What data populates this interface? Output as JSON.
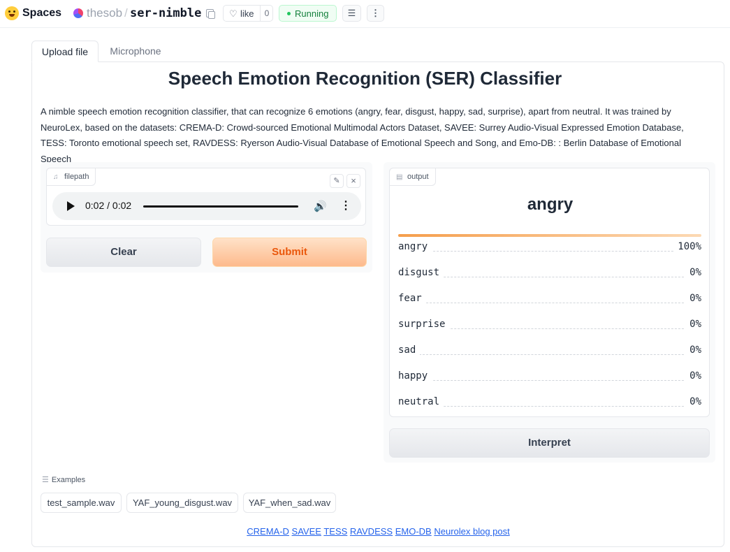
{
  "header": {
    "spaces_label": "Spaces",
    "owner": "thesob",
    "separator": "/",
    "repo": "ser-nimble",
    "like_label": "like",
    "like_count": "0",
    "status": "Running",
    "status_color": "#15803d",
    "logs_icon": "list-icon",
    "more_icon": "⋮"
  },
  "tabs": [
    {
      "label": "Upload file",
      "active": true
    },
    {
      "label": "Microphone",
      "active": false
    }
  ],
  "title": "Speech Emotion Recognition (SER) Classifier",
  "description": "A nimble speech emotion recognition classifier, that can recognize 6 emotions (angry, fear, disgust, happy, sad, surprise), apart from neutral. It was trained by NeuroLex, based on the datasets: CREMA-D: Crowd-sourced Emotional Multimodal Actors Dataset, SAVEE: Surrey Audio-Visual Expressed Emotion Database, TESS: Toronto emotional speech set, RAVDESS: Ryerson Audio-Visual Database of Emotional Speech and Song, and Emo-DB: : Berlin Database of Emotional Speech",
  "input": {
    "label": "filepath",
    "player_time": "0:02 / 0:02",
    "progress": 1.0
  },
  "buttons": {
    "clear": "Clear",
    "submit": "Submit",
    "interpret": "Interpret"
  },
  "output": {
    "label": "output",
    "predicted": "angry",
    "confidences": [
      {
        "label": "angry",
        "value": "100%",
        "fraction": 1.0
      },
      {
        "label": "disgust",
        "value": "0%",
        "fraction": 0
      },
      {
        "label": "fear",
        "value": "0%",
        "fraction": 0
      },
      {
        "label": "surprise",
        "value": "0%",
        "fraction": 0
      },
      {
        "label": "sad",
        "value": "0%",
        "fraction": 0
      },
      {
        "label": "happy",
        "value": "0%",
        "fraction": 0
      },
      {
        "label": "neutral",
        "value": "0%",
        "fraction": 0
      }
    ],
    "accent_color": "#f59e4c"
  },
  "examples": {
    "label": "Examples",
    "items": [
      "test_sample.wav",
      "YAF_young_disgust.wav",
      "YAF_when_sad.wav"
    ]
  },
  "footer_links": [
    "CREMA-D",
    "SAVEE",
    "TESS",
    "RAVDESS",
    "EMO-DB",
    "Neurolex blog post"
  ]
}
